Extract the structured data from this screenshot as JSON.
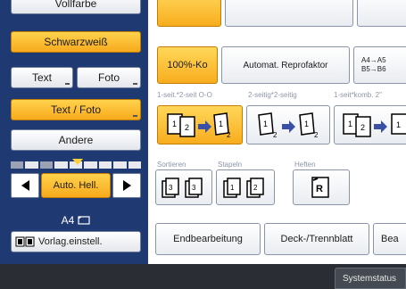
{
  "left_panel": {
    "vollfarbe": "Vollfarbe",
    "schwarzweiss": "Schwarzweiß",
    "text": "Text",
    "foto": "Foto",
    "text_foto": "Text / Foto",
    "andere": "Andere",
    "auto_hell": "Auto. Hell.",
    "paper_size": "A4",
    "vorlag_einstell": "Vorlag.einstell."
  },
  "right_panel": {
    "zoom": "100%-Ko",
    "auto_reduce": "Automat. Reprofaktor",
    "paper_sizes": "A4→A5 B5→B6",
    "duplex_labels": [
      "1-seit.*2-seit O-O",
      "2-seitig*2-seitig",
      "1-seit*komb. 2\""
    ],
    "finish_labels": [
      "Sortieren",
      "Stapeln",
      "Heften"
    ],
    "endbearbeitung": "Endbearbeitung",
    "deck_trennblatt": "Deck-/Trennblatt",
    "bea": "Bea"
  },
  "footer": {
    "status": "Systemstatus"
  },
  "colors": {
    "accent": "#f8ad1e",
    "panel": "#1f3a73"
  }
}
